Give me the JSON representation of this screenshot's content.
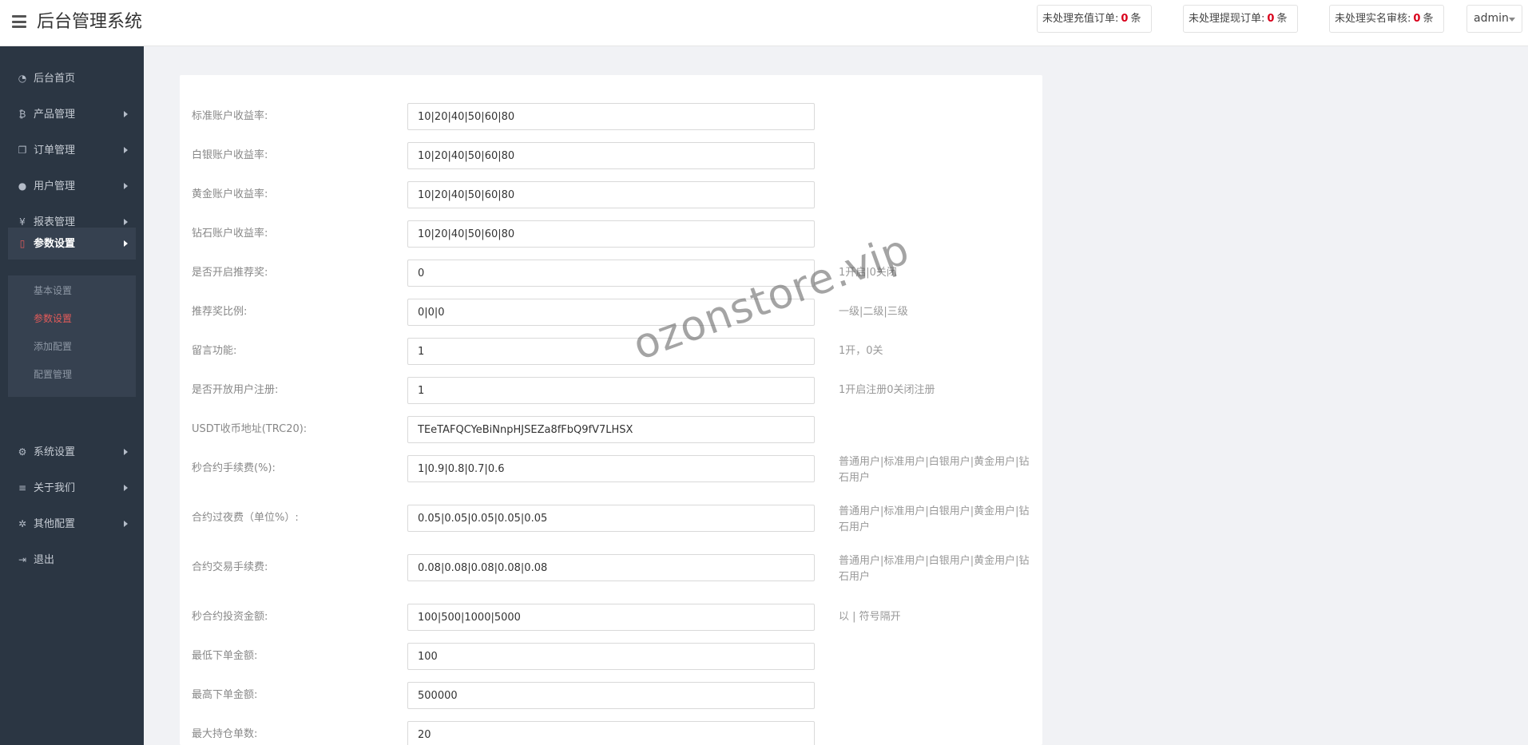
{
  "header": {
    "title": "后台管理系统",
    "counters": [
      {
        "label": "未处理充值订单:",
        "count": "0",
        "unit": "条"
      },
      {
        "label": "未处理提现订单:",
        "count": "0",
        "unit": "条"
      },
      {
        "label": "未处理实名审核:",
        "count": "0",
        "unit": "条"
      }
    ],
    "user": "admin"
  },
  "sidebar": {
    "items": [
      {
        "label": "后台首页",
        "icon": "dashboard-icon"
      },
      {
        "label": "产品管理",
        "icon": "bitcoin-icon"
      },
      {
        "label": "订单管理",
        "icon": "copy-icon"
      },
      {
        "label": "用户管理",
        "icon": "user-icon"
      },
      {
        "label": "报表管理",
        "icon": "yen-icon"
      },
      {
        "label": "参数设置",
        "icon": "file-icon"
      },
      {
        "label": "系统设置",
        "icon": "cogs-icon"
      },
      {
        "label": "关于我们",
        "icon": "list-icon"
      },
      {
        "label": "其他配置",
        "icon": "gear-icon"
      },
      {
        "label": "退出",
        "icon": "sign-out-icon"
      }
    ],
    "submenu": [
      {
        "label": "基本设置"
      },
      {
        "label": "参数设置"
      },
      {
        "label": "添加配置"
      },
      {
        "label": "配置管理"
      }
    ]
  },
  "form": {
    "rows": [
      {
        "label": "标准账户收益率:",
        "value": "10|20|40|50|60|80",
        "hint": ""
      },
      {
        "label": "白银账户收益率:",
        "value": "10|20|40|50|60|80",
        "hint": ""
      },
      {
        "label": "黄金账户收益率:",
        "value": "10|20|40|50|60|80",
        "hint": ""
      },
      {
        "label": "钻石账户收益率:",
        "value": "10|20|40|50|60|80",
        "hint": ""
      },
      {
        "label": "是否开启推荐奖:",
        "value": "0",
        "hint": "1开启|0关闭"
      },
      {
        "label": "推荐奖比例:",
        "value": "0|0|0",
        "hint": "一级|二级|三级"
      },
      {
        "label": "留言功能:",
        "value": "1",
        "hint": "1开，0关"
      },
      {
        "label": "是否开放用户注册:",
        "value": "1",
        "hint": "1开启注册0关闭注册"
      },
      {
        "label": "USDT收币地址(TRC20):",
        "value": "TEeTAFQCYeBiNnpHJSEZa8fFbQ9fV7LHSX",
        "hint": ""
      },
      {
        "label": "秒合约手续费(%):",
        "value": "1|0.9|0.8|0.7|0.6",
        "hint": "普通用户|标准用户|白银用户|黄金用户|钻石用户"
      },
      {
        "label": "合约过夜费（单位%）:",
        "value": "0.05|0.05|0.05|0.05|0.05",
        "hint": "普通用户|标准用户|白银用户|黄金用户|钻石用户"
      },
      {
        "label": "合约交易手续费:",
        "value": "0.08|0.08|0.08|0.08|0.08",
        "hint": "普通用户|标准用户|白银用户|黄金用户|钻石用户"
      },
      {
        "label": "秒合约投资金额:",
        "value": "100|500|1000|5000",
        "hint": "以 | 符号隔开"
      },
      {
        "label": "最低下单金额:",
        "value": "100",
        "hint": ""
      },
      {
        "label": "最高下单金额:",
        "value": "500000",
        "hint": ""
      },
      {
        "label": "最大持仓单数:",
        "value": "20",
        "hint": ""
      }
    ]
  },
  "watermark": "ozonstore.vip"
}
